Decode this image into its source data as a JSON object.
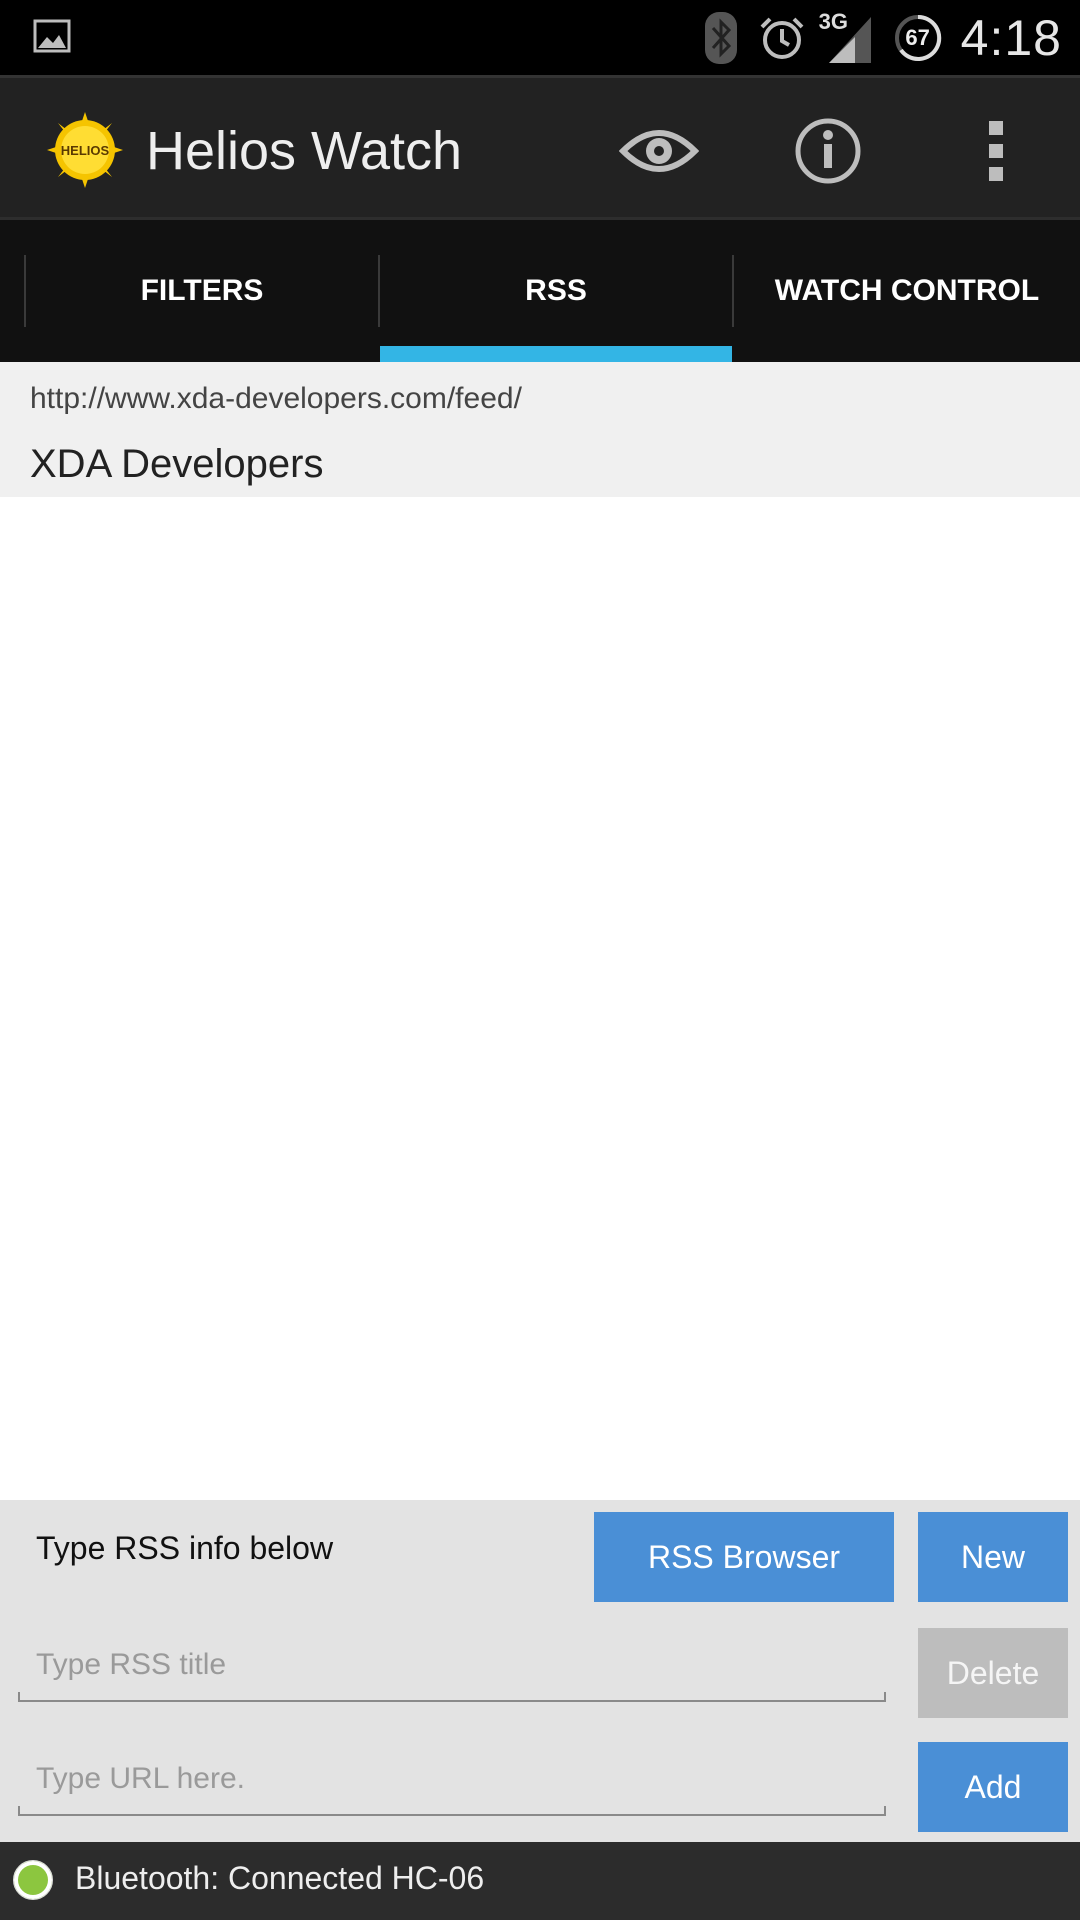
{
  "status_bar": {
    "time": "4:18",
    "network": "3G",
    "battery": "67",
    "icons": [
      "image-notification-icon",
      "bluetooth-icon",
      "alarm-icon",
      "signal-icon",
      "battery-icon"
    ]
  },
  "action_bar": {
    "title": "Helios Watch",
    "logo_text": "HELIOS",
    "actions": [
      "eye-icon",
      "info-icon",
      "overflow-menu-icon"
    ]
  },
  "tabs": [
    {
      "label": "FILTERS",
      "selected": false
    },
    {
      "label": "RSS",
      "selected": true
    },
    {
      "label": "WATCH CONTROL",
      "selected": false
    }
  ],
  "feeds": [
    {
      "url": "http://www.xda-developers.com/feed/",
      "title": "XDA Developers"
    }
  ],
  "panel": {
    "hint": "Type RSS info below",
    "rss_browser_label": "RSS Browser",
    "new_label": "New",
    "delete_label": "Delete",
    "add_label": "Add",
    "title_placeholder": "Type RSS title",
    "url_placeholder": "Type URL here."
  },
  "bluetooth": {
    "status": "Bluetooth: Connected HC-06"
  },
  "colors": {
    "accent": "#33b5e5",
    "button_blue": "#4a8fd6",
    "connected_green": "#8cc63f"
  }
}
